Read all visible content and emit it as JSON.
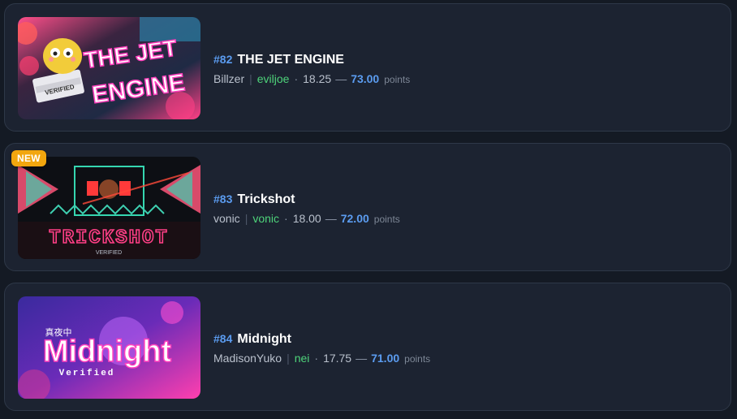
{
  "levels": [
    {
      "rank": "#82",
      "name": "THE JET ENGINE",
      "creator": "Billzer",
      "verifier": "eviljoe",
      "score": "18.25",
      "points": "73.00",
      "points_label": "points",
      "thumb_text": [
        "THE JET",
        "ENGINE"
      ],
      "thumb_tag": "VERIFIED"
    },
    {
      "rank": "#83",
      "name": "Trickshot",
      "creator": "vonic",
      "verifier": "vonic",
      "score": "18.00",
      "points": "72.00",
      "points_label": "points",
      "badge": "NEW",
      "thumb_text": [
        "TRICKSHOT"
      ],
      "thumb_tag": "VERIFIED"
    },
    {
      "rank": "#84",
      "name": "Midnight",
      "creator": "MadisonYuko",
      "verifier": "nei",
      "score": "17.75",
      "points": "71.00",
      "points_label": "points",
      "thumb_text": [
        "Midnight",
        "真夜中"
      ],
      "thumb_tag": "Verified"
    }
  ],
  "colors": {
    "rank": "#5b9cf0",
    "verifier": "#4ed37a",
    "points": "#5b9cf0",
    "badge": "#f2a60e",
    "card_bg": "#1c2331"
  },
  "separators": {
    "pipe": "|",
    "dot": "·",
    "dash": "—"
  }
}
